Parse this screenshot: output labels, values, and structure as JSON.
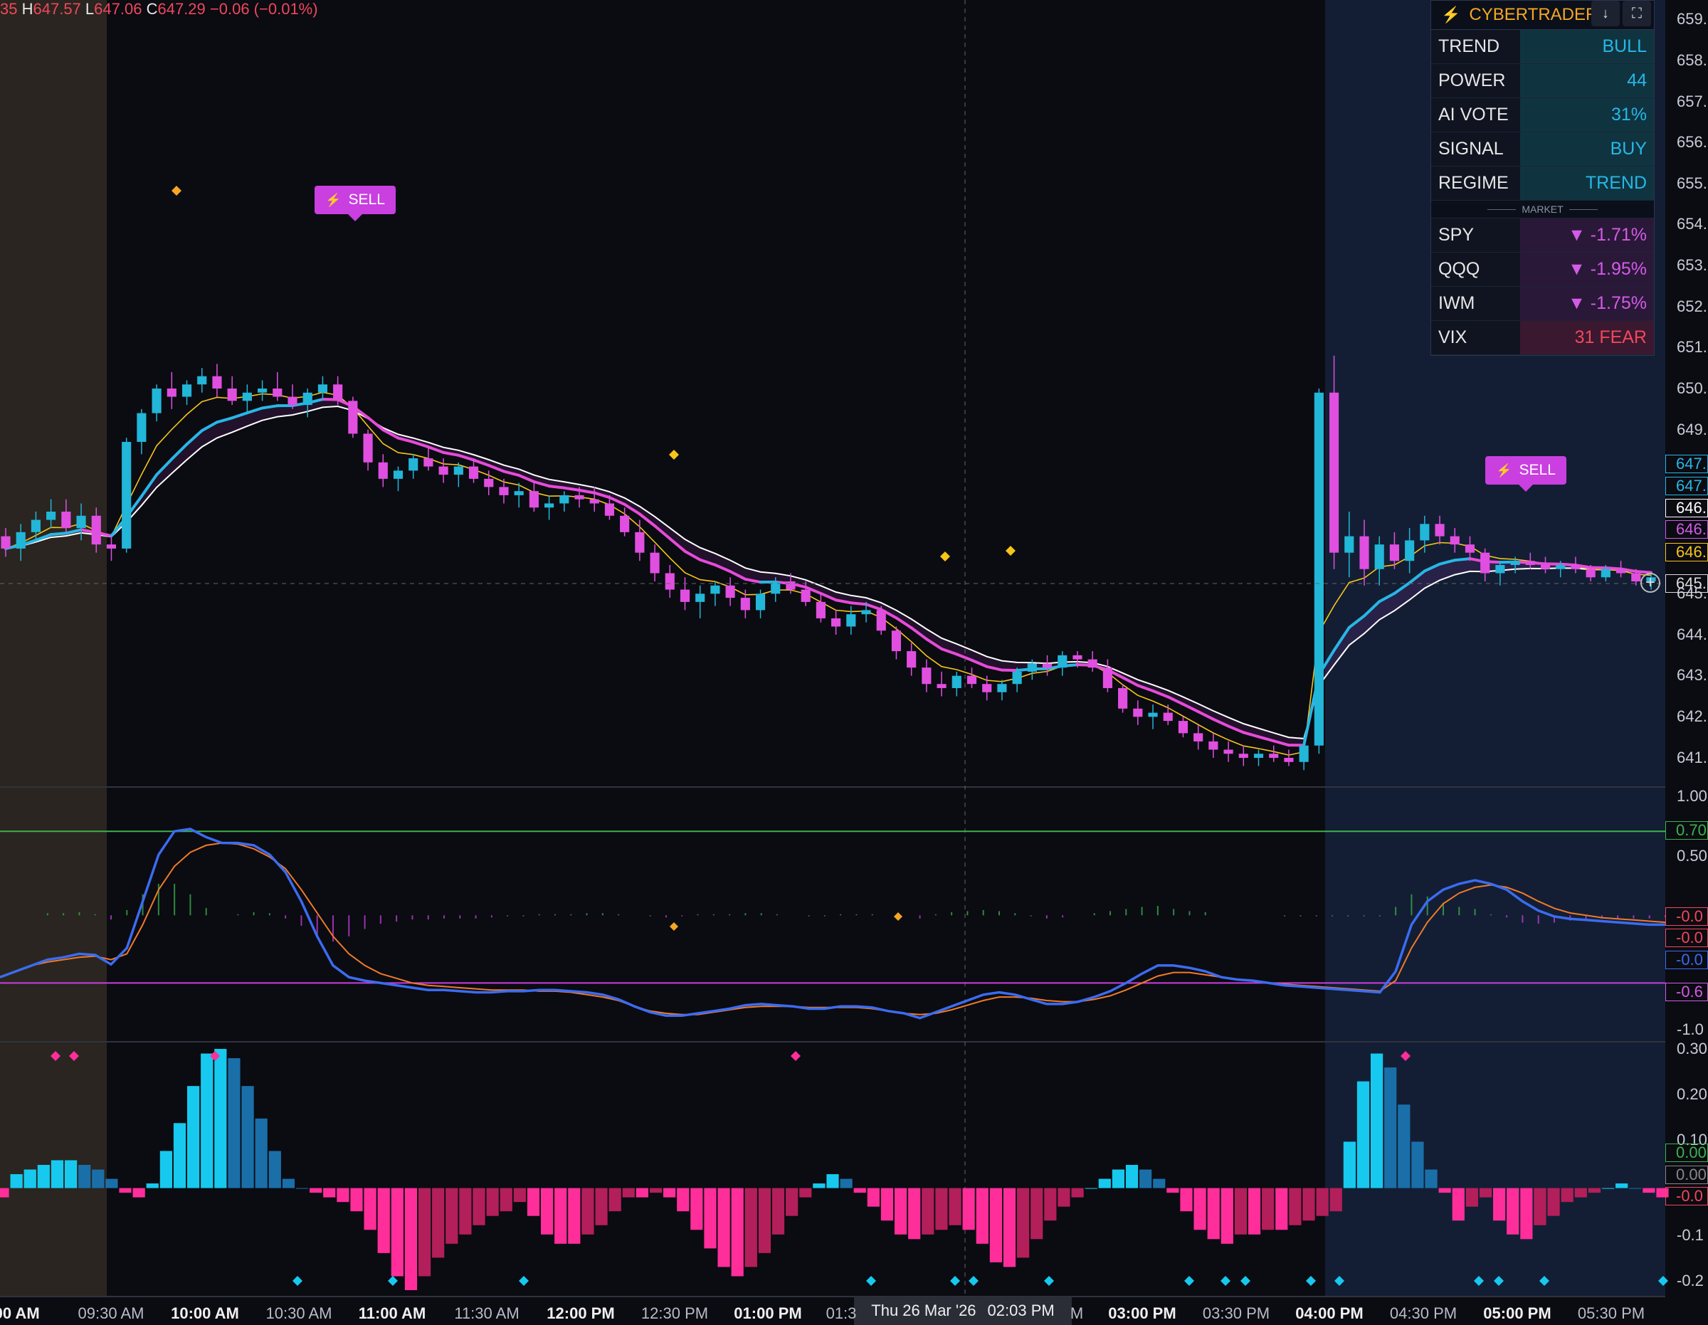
{
  "header": {
    "ohlc_prefix": "35",
    "h_label": "H",
    "h_value": "647.57",
    "l_label": "L",
    "l_value": "647.06",
    "c_label": "C",
    "c_value": "647.29",
    "change": "−0.06 (−0.01%)"
  },
  "panel": {
    "title": "CYBERTRADER",
    "rows": [
      {
        "label": "TREND",
        "value": "BULL",
        "tone": "teal"
      },
      {
        "label": "POWER",
        "value": "44",
        "tone": "teal"
      },
      {
        "label": "AI VOTE",
        "value": "31%",
        "tone": "teal"
      },
      {
        "label": "SIGNAL",
        "value": "BUY",
        "tone": "teal"
      },
      {
        "label": "REGIME",
        "value": "TREND",
        "tone": "teal"
      }
    ],
    "market_label": "MARKET",
    "market_rows": [
      {
        "label": "SPY",
        "value": "▼ -1.71%",
        "tone": "purple"
      },
      {
        "label": "QQQ",
        "value": "▼ -1.95%",
        "tone": "purple"
      },
      {
        "label": "IWM",
        "value": "▼ -1.75%",
        "tone": "purple"
      },
      {
        "label": "VIX",
        "value": "31 FEAR",
        "tone": "red"
      }
    ]
  },
  "signals": [
    {
      "label": "SELL"
    },
    {
      "label": "SELL"
    }
  ],
  "crosshair": {
    "date": "Thu 26 Mar '26",
    "time": "02:03 PM"
  },
  "time_labels": [
    {
      "text": ":00 AM",
      "bold": true
    },
    {
      "text": "09:30 AM",
      "bold": false
    },
    {
      "text": "10:00 AM",
      "bold": true
    },
    {
      "text": "10:30 AM",
      "bold": false
    },
    {
      "text": "11:00 AM",
      "bold": true
    },
    {
      "text": "11:30 AM",
      "bold": false
    },
    {
      "text": "12:00 PM",
      "bold": true
    },
    {
      "text": "12:30 PM",
      "bold": false
    },
    {
      "text": "01:00 PM",
      "bold": true
    },
    {
      "text": "01:3",
      "bold": false
    },
    {
      "text": "M",
      "bold": false
    },
    {
      "text": "03:00 PM",
      "bold": true
    },
    {
      "text": "03:30 PM",
      "bold": false
    },
    {
      "text": "04:00 PM",
      "bold": true
    },
    {
      "text": "04:30 PM",
      "bold": false
    },
    {
      "text": "05:00 PM",
      "bold": true
    },
    {
      "text": "05:30 PM",
      "bold": false
    }
  ],
  "price_axis": [
    "659.",
    "658.",
    "657.",
    "656.",
    "655.",
    "654.",
    "653.",
    "652.",
    "651.",
    "650.",
    "649.",
    "645.",
    "644.",
    "643.",
    "642.",
    "641."
  ],
  "price_boxes": [
    {
      "text": "647.",
      "color": "#27b7e6"
    },
    {
      "text": "647.",
      "color": "#27b7e6"
    },
    {
      "text": "646.",
      "color": "#ffffff"
    },
    {
      "text": "646.",
      "color": "#d45be8"
    },
    {
      "text": "646.",
      "color": "#f5c518"
    },
    {
      "text": "645.",
      "color": "#dddddd"
    }
  ],
  "osc_axis": [
    "1.00",
    "0.50",
    "-1.0"
  ],
  "osc_boxes": [
    {
      "text": "0.70",
      "color": "#3bb34a"
    },
    {
      "text": "-0.0",
      "color": "#f0485a"
    },
    {
      "text": "-0.0",
      "color": "#f0485a"
    },
    {
      "text": "-0.0",
      "color": "#3b6cf0"
    },
    {
      "text": "-0.6",
      "color": "#d45be8"
    }
  ],
  "hist_axis": [
    "0.30",
    "0.20",
    "0.10",
    "-0.1",
    "-0.2"
  ],
  "hist_boxes": [
    {
      "text": "0.00",
      "color": "#3bb34a"
    },
    {
      "text": "0.00",
      "color": "#888888"
    },
    {
      "text": "-0.0",
      "color": "#f0485a"
    }
  ],
  "colors": {
    "bull": "#22b6d8",
    "bear": "#e04fe0",
    "ema_fast": "#f5c518",
    "ema_mid": "#ffffff",
    "trend_bull": "#27b7e6",
    "trend_bear": "#e64bd8",
    "osc_fast": "#3b6cf0",
    "osc_slow": "#f07a28",
    "overbought": "#3bb34a",
    "oversold": "#c93fe0"
  },
  "chart_data": {
    "type": "candlestick",
    "ylim": [
      640.6,
      659.4
    ],
    "candles": [
      [
        646.4,
        646.6,
        645.9,
        646.1
      ],
      [
        646.1,
        646.7,
        645.8,
        646.5
      ],
      [
        646.5,
        647.0,
        646.3,
        646.8
      ],
      [
        646.8,
        647.3,
        646.6,
        647.0
      ],
      [
        647.0,
        647.3,
        646.5,
        646.6
      ],
      [
        646.6,
        647.2,
        646.3,
        646.9
      ],
      [
        646.9,
        647.1,
        646.0,
        646.2
      ],
      [
        646.2,
        646.4,
        645.8,
        646.1
      ],
      [
        646.1,
        648.8,
        646.0,
        648.7
      ],
      [
        648.7,
        649.5,
        648.4,
        649.4
      ],
      [
        649.4,
        650.1,
        649.2,
        650.0
      ],
      [
        650.0,
        650.4,
        649.5,
        649.8
      ],
      [
        649.8,
        650.2,
        649.6,
        650.1
      ],
      [
        650.1,
        650.5,
        649.9,
        650.3
      ],
      [
        650.3,
        650.6,
        649.8,
        650.0
      ],
      [
        650.0,
        650.3,
        649.6,
        649.7
      ],
      [
        649.7,
        650.1,
        649.4,
        649.9
      ],
      [
        649.9,
        650.2,
        649.7,
        650.0
      ],
      [
        650.0,
        650.4,
        649.7,
        649.8
      ],
      [
        649.8,
        650.1,
        649.5,
        649.6
      ],
      [
        649.6,
        650.0,
        649.3,
        649.9
      ],
      [
        649.9,
        650.3,
        649.7,
        650.1
      ],
      [
        650.1,
        650.3,
        649.6,
        649.7
      ],
      [
        649.7,
        649.8,
        648.8,
        648.9
      ],
      [
        648.9,
        649.0,
        648.0,
        648.2
      ],
      [
        648.2,
        648.4,
        647.6,
        647.8
      ],
      [
        647.8,
        648.1,
        647.5,
        648.0
      ],
      [
        648.0,
        648.4,
        647.8,
        648.3
      ],
      [
        648.3,
        648.6,
        648.0,
        648.1
      ],
      [
        648.1,
        648.3,
        647.7,
        647.9
      ],
      [
        647.9,
        648.2,
        647.6,
        648.1
      ],
      [
        648.1,
        648.3,
        647.7,
        647.8
      ],
      [
        647.8,
        648.0,
        647.4,
        647.6
      ],
      [
        647.6,
        647.8,
        647.2,
        647.4
      ],
      [
        647.4,
        647.7,
        647.1,
        647.5
      ],
      [
        647.5,
        647.7,
        647.0,
        647.1
      ],
      [
        647.1,
        647.4,
        646.8,
        647.2
      ],
      [
        647.2,
        647.5,
        647.0,
        647.4
      ],
      [
        647.4,
        647.6,
        647.1,
        647.3
      ],
      [
        647.3,
        647.6,
        647.0,
        647.2
      ],
      [
        647.2,
        647.4,
        646.8,
        646.9
      ],
      [
        646.9,
        647.1,
        646.4,
        646.5
      ],
      [
        646.5,
        646.8,
        645.8,
        646.0
      ],
      [
        646.0,
        646.2,
        645.3,
        645.5
      ],
      [
        645.5,
        645.7,
        644.9,
        645.1
      ],
      [
        645.1,
        645.4,
        644.6,
        644.8
      ],
      [
        644.8,
        645.2,
        644.4,
        645.0
      ],
      [
        645.0,
        645.3,
        644.7,
        645.2
      ],
      [
        645.2,
        645.4,
        644.7,
        644.9
      ],
      [
        644.9,
        645.1,
        644.4,
        644.6
      ],
      [
        644.6,
        645.1,
        644.4,
        645.0
      ],
      [
        645.0,
        645.4,
        644.8,
        645.3
      ],
      [
        645.3,
        645.5,
        645.0,
        645.1
      ],
      [
        645.1,
        645.3,
        644.7,
        644.8
      ],
      [
        644.8,
        645.0,
        644.3,
        644.4
      ],
      [
        644.4,
        644.6,
        644.0,
        644.2
      ],
      [
        644.2,
        644.7,
        644.0,
        644.5
      ],
      [
        644.5,
        644.8,
        644.3,
        644.6
      ],
      [
        644.6,
        644.7,
        644.0,
        644.1
      ],
      [
        644.1,
        644.2,
        643.4,
        643.6
      ],
      [
        643.6,
        643.8,
        643.0,
        643.2
      ],
      [
        643.2,
        643.4,
        642.6,
        642.8
      ],
      [
        642.8,
        643.1,
        642.5,
        642.7
      ],
      [
        642.7,
        643.1,
        642.5,
        643.0
      ],
      [
        643.0,
        643.2,
        642.7,
        642.8
      ],
      [
        642.8,
        643.0,
        642.4,
        642.6
      ],
      [
        642.6,
        642.9,
        642.4,
        642.8
      ],
      [
        642.8,
        643.2,
        642.6,
        643.1
      ],
      [
        643.1,
        643.4,
        642.9,
        643.3
      ],
      [
        643.3,
        643.5,
        643.0,
        643.2
      ],
      [
        643.2,
        643.6,
        643.0,
        643.5
      ],
      [
        643.5,
        643.6,
        643.2,
        643.4
      ],
      [
        643.4,
        643.6,
        643.1,
        643.2
      ],
      [
        643.2,
        643.4,
        642.6,
        642.7
      ],
      [
        642.7,
        642.8,
        642.1,
        642.2
      ],
      [
        642.2,
        642.4,
        641.8,
        642.0
      ],
      [
        642.0,
        642.3,
        641.7,
        642.1
      ],
      [
        642.1,
        642.3,
        641.8,
        641.9
      ],
      [
        641.9,
        642.0,
        641.5,
        641.6
      ],
      [
        641.6,
        641.8,
        641.2,
        641.4
      ],
      [
        641.4,
        641.6,
        641.0,
        641.2
      ],
      [
        641.2,
        641.4,
        640.9,
        641.1
      ],
      [
        641.1,
        641.3,
        640.8,
        641.0
      ],
      [
        641.0,
        641.2,
        640.8,
        641.1
      ],
      [
        641.1,
        641.3,
        640.9,
        641.0
      ],
      [
        641.0,
        641.2,
        640.8,
        640.9
      ],
      [
        640.9,
        641.5,
        640.7,
        641.3
      ],
      [
        641.3,
        650.0,
        641.1,
        649.9
      ],
      [
        649.9,
        650.8,
        645.6,
        646.0
      ],
      [
        646.0,
        647.0,
        645.4,
        646.4
      ],
      [
        646.4,
        646.8,
        645.2,
        645.6
      ],
      [
        645.6,
        646.4,
        645.2,
        646.2
      ],
      [
        646.2,
        646.5,
        645.6,
        645.8
      ],
      [
        645.8,
        646.6,
        645.5,
        646.3
      ],
      [
        646.3,
        646.9,
        646.0,
        646.7
      ],
      [
        646.7,
        646.9,
        646.2,
        646.4
      ],
      [
        646.4,
        646.6,
        646.0,
        646.2
      ],
      [
        646.2,
        646.4,
        645.8,
        646.0
      ],
      [
        646.0,
        646.1,
        645.3,
        645.5
      ],
      [
        645.5,
        645.8,
        645.2,
        645.7
      ],
      [
        645.7,
        645.9,
        645.5,
        645.8
      ],
      [
        645.8,
        646.0,
        645.6,
        645.7
      ],
      [
        645.7,
        645.9,
        645.5,
        645.6
      ],
      [
        645.6,
        645.8,
        645.4,
        645.7
      ],
      [
        645.7,
        645.9,
        645.5,
        645.6
      ],
      [
        645.6,
        645.7,
        645.3,
        645.4
      ],
      [
        645.4,
        645.7,
        645.3,
        645.6
      ],
      [
        645.6,
        645.8,
        645.4,
        645.5
      ],
      [
        645.5,
        645.6,
        645.2,
        645.3
      ],
      [
        645.3,
        645.5,
        645.1,
        645.4
      ]
    ],
    "histogram": [
      -0.02,
      0.03,
      0.04,
      0.05,
      0.06,
      0.06,
      0.05,
      0.04,
      0.02,
      -0.01,
      -0.02,
      0.01,
      0.08,
      0.14,
      0.22,
      0.29,
      0.3,
      0.28,
      0.22,
      0.15,
      0.08,
      0.02,
      0.0,
      -0.01,
      -0.02,
      -0.03,
      -0.05,
      -0.09,
      -0.14,
      -0.19,
      -0.22,
      -0.19,
      -0.15,
      -0.12,
      -0.1,
      -0.08,
      -0.06,
      -0.05,
      -0.03,
      -0.06,
      -0.1,
      -0.12,
      -0.12,
      -0.1,
      -0.08,
      -0.05,
      -0.02,
      -0.02,
      -0.01,
      -0.02,
      -0.05,
      -0.09,
      -0.13,
      -0.17,
      -0.19,
      -0.17,
      -0.14,
      -0.1,
      -0.06,
      -0.02,
      0.01,
      0.03,
      0.02,
      -0.01,
      -0.04,
      -0.07,
      -0.1,
      -0.11,
      -0.1,
      -0.09,
      -0.08,
      -0.09,
      -0.12,
      -0.16,
      -0.17,
      -0.15,
      -0.11,
      -0.07,
      -0.04,
      -0.02,
      0.0,
      0.02,
      0.04,
      0.05,
      0.04,
      0.02,
      -0.01,
      -0.05,
      -0.09,
      -0.11,
      -0.12,
      -0.1,
      -0.1,
      -0.09,
      -0.09,
      -0.08,
      -0.07,
      -0.06,
      -0.05,
      0.1,
      0.23,
      0.29,
      0.26,
      0.18,
      0.1,
      0.04,
      -0.01,
      -0.07,
      -0.04,
      -0.02,
      -0.07,
      -0.1,
      -0.11,
      -0.08,
      -0.06,
      -0.03,
      -0.02,
      -0.01,
      0.0,
      0.01,
      0.0,
      -0.01,
      -0.02
    ],
    "oscillator": {
      "fast": [
        -0.55,
        -0.5,
        -0.45,
        -0.4,
        -0.38,
        -0.35,
        -0.36,
        -0.44,
        -0.3,
        0.1,
        0.5,
        0.7,
        0.72,
        0.65,
        0.6,
        0.6,
        0.58,
        0.5,
        0.35,
        0.1,
        -0.2,
        -0.45,
        -0.55,
        -0.58,
        -0.6,
        -0.62,
        -0.64,
        -0.66,
        -0.66,
        -0.67,
        -0.68,
        -0.68,
        -0.67,
        -0.67,
        -0.66,
        -0.66,
        -0.67,
        -0.68,
        -0.7,
        -0.74,
        -0.8,
        -0.85,
        -0.88,
        -0.88,
        -0.86,
        -0.84,
        -0.82,
        -0.79,
        -0.78,
        -0.79,
        -0.8,
        -0.82,
        -0.82,
        -0.8,
        -0.8,
        -0.81,
        -0.84,
        -0.86,
        -0.9,
        -0.85,
        -0.8,
        -0.75,
        -0.7,
        -0.68,
        -0.7,
        -0.74,
        -0.78,
        -0.78,
        -0.76,
        -0.72,
        -0.67,
        -0.6,
        -0.52,
        -0.45,
        -0.45,
        -0.47,
        -0.5,
        -0.55,
        -0.57,
        -0.58,
        -0.6,
        -0.62,
        -0.63,
        -0.64,
        -0.65,
        -0.66,
        -0.67,
        -0.68,
        -0.5,
        -0.1,
        0.1,
        0.2,
        0.25,
        0.28,
        0.25,
        0.2,
        0.1,
        0.02,
        -0.03,
        -0.05,
        -0.06,
        -0.07,
        -0.08,
        -0.09,
        -0.1,
        -0.1
      ],
      "slow": [
        -0.55,
        -0.5,
        -0.45,
        -0.42,
        -0.4,
        -0.38,
        -0.37,
        -0.4,
        -0.35,
        -0.1,
        0.2,
        0.4,
        0.52,
        0.58,
        0.6,
        0.59,
        0.55,
        0.48,
        0.38,
        0.2,
        0.0,
        -0.2,
        -0.35,
        -0.45,
        -0.52,
        -0.56,
        -0.6,
        -0.62,
        -0.63,
        -0.64,
        -0.65,
        -0.66,
        -0.66,
        -0.66,
        -0.67,
        -0.67,
        -0.68,
        -0.7,
        -0.72,
        -0.75,
        -0.8,
        -0.84,
        -0.86,
        -0.87,
        -0.87,
        -0.85,
        -0.83,
        -0.81,
        -0.8,
        -0.8,
        -0.8,
        -0.81,
        -0.81,
        -0.81,
        -0.81,
        -0.82,
        -0.84,
        -0.86,
        -0.87,
        -0.86,
        -0.83,
        -0.79,
        -0.75,
        -0.72,
        -0.72,
        -0.73,
        -0.75,
        -0.76,
        -0.76,
        -0.74,
        -0.71,
        -0.66,
        -0.6,
        -0.54,
        -0.51,
        -0.51,
        -0.53,
        -0.55,
        -0.57,
        -0.58,
        -0.6,
        -0.61,
        -0.62,
        -0.63,
        -0.64,
        -0.65,
        -0.66,
        -0.67,
        -0.58,
        -0.3,
        -0.08,
        0.08,
        0.17,
        0.22,
        0.24,
        0.22,
        0.17,
        0.1,
        0.04,
        0.0,
        -0.02,
        -0.04,
        -0.05,
        -0.06,
        -0.07,
        -0.08
      ],
      "overbought": 0.7,
      "oversold": -0.6
    }
  }
}
